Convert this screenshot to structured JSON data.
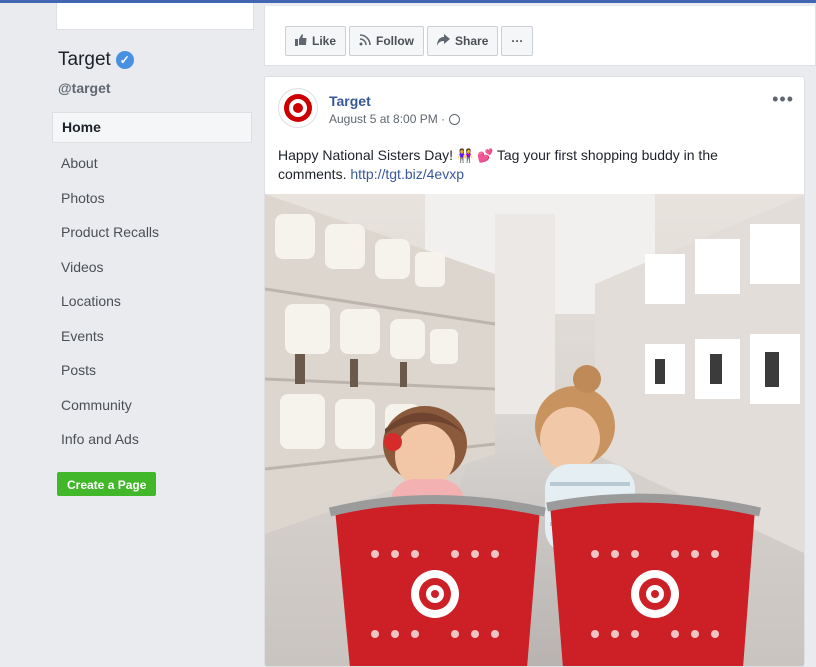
{
  "page": {
    "name": "Target",
    "handle": "@target"
  },
  "nav": {
    "items": [
      {
        "label": "Home"
      },
      {
        "label": "About"
      },
      {
        "label": "Photos"
      },
      {
        "label": "Product Recalls"
      },
      {
        "label": "Videos"
      },
      {
        "label": "Locations"
      },
      {
        "label": "Events"
      },
      {
        "label": "Posts"
      },
      {
        "label": "Community"
      },
      {
        "label": "Info and Ads"
      }
    ],
    "active": "Home",
    "create_page_label": "Create a Page"
  },
  "actions": {
    "like": "Like",
    "follow": "Follow",
    "share": "Share",
    "more": "···"
  },
  "post": {
    "author": "Target",
    "timestamp": "August 5 at 8:00 PM · ",
    "text_before": "Happy National Sisters Day! ",
    "text_after": " Tag your first shopping buddy in the comments. ",
    "link": "http://tgt.biz/4evxp",
    "more": "•••"
  },
  "colors": {
    "brand": "#4267b2",
    "link": "#385898",
    "create_button": "#42b72a",
    "target_red": "#cc0000"
  },
  "icons": {
    "like": "thumbs-up-icon",
    "follow": "rss-icon",
    "share": "share-arrow-icon",
    "verified": "verified-check-icon",
    "privacy": "globe-icon"
  }
}
